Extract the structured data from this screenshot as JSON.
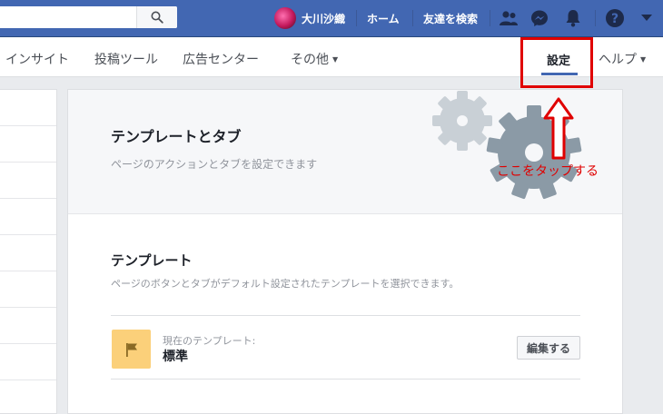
{
  "topbar": {
    "user_name": "大川沙織",
    "nav": [
      "ホーム",
      "友達を検索"
    ],
    "icons": [
      "friends-icon",
      "messenger-icon",
      "bell-icon",
      "help-icon",
      "caret-down-icon"
    ],
    "search_icon": "search-icon"
  },
  "subnav": {
    "items": [
      "インサイト",
      "投稿ツール",
      "広告センター",
      "その他"
    ],
    "caret": "▼",
    "active": "設定",
    "help": "ヘルプ"
  },
  "panel": {
    "title": "テンプレートとタブ",
    "subtitle": "ページのアクションとタブを設定できます",
    "section_title": "テンプレート",
    "section_subtitle": "ページのボタンとタブがデフォルト設定されたテンプレートを選択できます。",
    "current_label": "現在のテンプレート:",
    "current_value": "標準",
    "edit_button": "編集する"
  },
  "annotation": {
    "text": "ここをタップする"
  },
  "colors": {
    "brand": "#4267b2",
    "annotation": "#e00000",
    "template_icon_bg": "#fbd07a"
  }
}
